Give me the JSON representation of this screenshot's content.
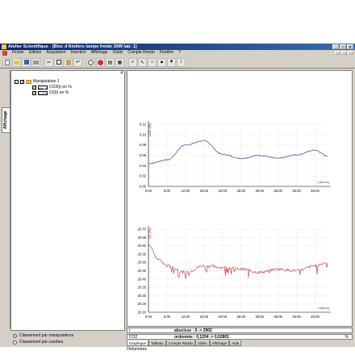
{
  "window": {
    "title": "Atelier Scientifique - [Bloc d'Ateliers lampe froide 20W lab: 1]"
  },
  "menu": [
    "Fichier",
    "Edition",
    "Acquisition",
    "Insertion",
    "Affichage",
    "Outils",
    "Compte Rendu",
    "Fenêtre",
    "?"
  ],
  "toolbar_icons": [
    "new-icon",
    "open-icon",
    "save-icon",
    "print-icon",
    "cut-icon",
    "copy-icon",
    "paste-icon",
    "undo-icon",
    "settings-icon",
    "acquisition-icon",
    "chart-icon",
    "table-icon",
    "zoom-icon",
    "cursor-icon",
    "home-icon",
    "arrow-up-icon",
    "arrow-down-icon",
    "info-icon"
  ],
  "left_tab": "Affichage",
  "tree": {
    "panel_marker": "4",
    "root": "Manipulation 1",
    "items": [
      {
        "label": "CO2(t) en %",
        "color": "#3040a0"
      },
      {
        "label": "O2(t) en %",
        "color": "#c03030"
      }
    ]
  },
  "radios": [
    {
      "label": "Classement par manipulations",
      "selected": true
    },
    {
      "label": "Classement par courbes",
      "selected": false
    }
  ],
  "readout": {
    "row1": {
      "col1": "t",
      "col2": "abscisse : 0 -> 2902"
    },
    "row2": {
      "col1": "CO2",
      "col2": "ordonnée : 0,1204 -> 0,02801",
      "col3": "%"
    }
  },
  "tabs": [
    "Graphique",
    "Tableau",
    "Compte Rendu",
    "Vidéo",
    "Affichage",
    "Aide"
  ],
  "status": "Ordonnées",
  "colors": {
    "co2": "#2a2e8a",
    "o2": "#c0303a"
  },
  "chart_data": [
    {
      "type": "line",
      "series": [
        {
          "name": "CO2 (%)",
          "x": [
            0,
            300,
            600,
            900,
            1200,
            1500,
            1800,
            2100,
            2400,
            2700,
            2902
          ],
          "values": [
            0.044,
            0.051,
            0.08,
            0.088,
            0.062,
            0.054,
            0.06,
            0.054,
            0.061,
            0.07,
            0.059
          ]
        }
      ],
      "ylabel": "CO2 (%)",
      "xlabel": "t (min:s)",
      "yticks": [
        "0.12",
        "0.10",
        "0.08",
        "0.06",
        "0.04",
        "0.02",
        "0.00"
      ],
      "xticks": [
        "0:00",
        "5:00",
        "10:00",
        "15:00",
        "20:00",
        "25:00",
        "30:00",
        "35:00",
        "40:00",
        "45:00"
      ],
      "ylim": [
        0,
        0.12
      ],
      "xlim": [
        0,
        2902
      ]
    },
    {
      "type": "line",
      "series": [
        {
          "name": "O2 (%)",
          "x": [
            0,
            150,
            300,
            600,
            900,
            1200,
            1500,
            1800,
            2100,
            2400,
            2700,
            2902
          ],
          "values": [
            20.61,
            20.52,
            20.48,
            20.44,
            20.48,
            20.47,
            20.46,
            20.44,
            20.46,
            20.45,
            20.48,
            20.5
          ]
        }
      ],
      "ylabel": "O2 (%)",
      "xlabel": "t (min:s)",
      "yticks": [
        "20.70",
        "20.65",
        "20.60",
        "20.55",
        "20.50",
        "20.45",
        "20.40",
        "20.35",
        "20.30",
        "20.25",
        "20.20"
      ],
      "xticks": [
        "0:00",
        "5:00",
        "10:00",
        "15:00",
        "20:00",
        "25:00",
        "30:00",
        "35:00",
        "40:00",
        "45:00"
      ],
      "ylim": [
        20.2,
        20.7
      ],
      "xlim": [
        0,
        2902
      ]
    }
  ]
}
